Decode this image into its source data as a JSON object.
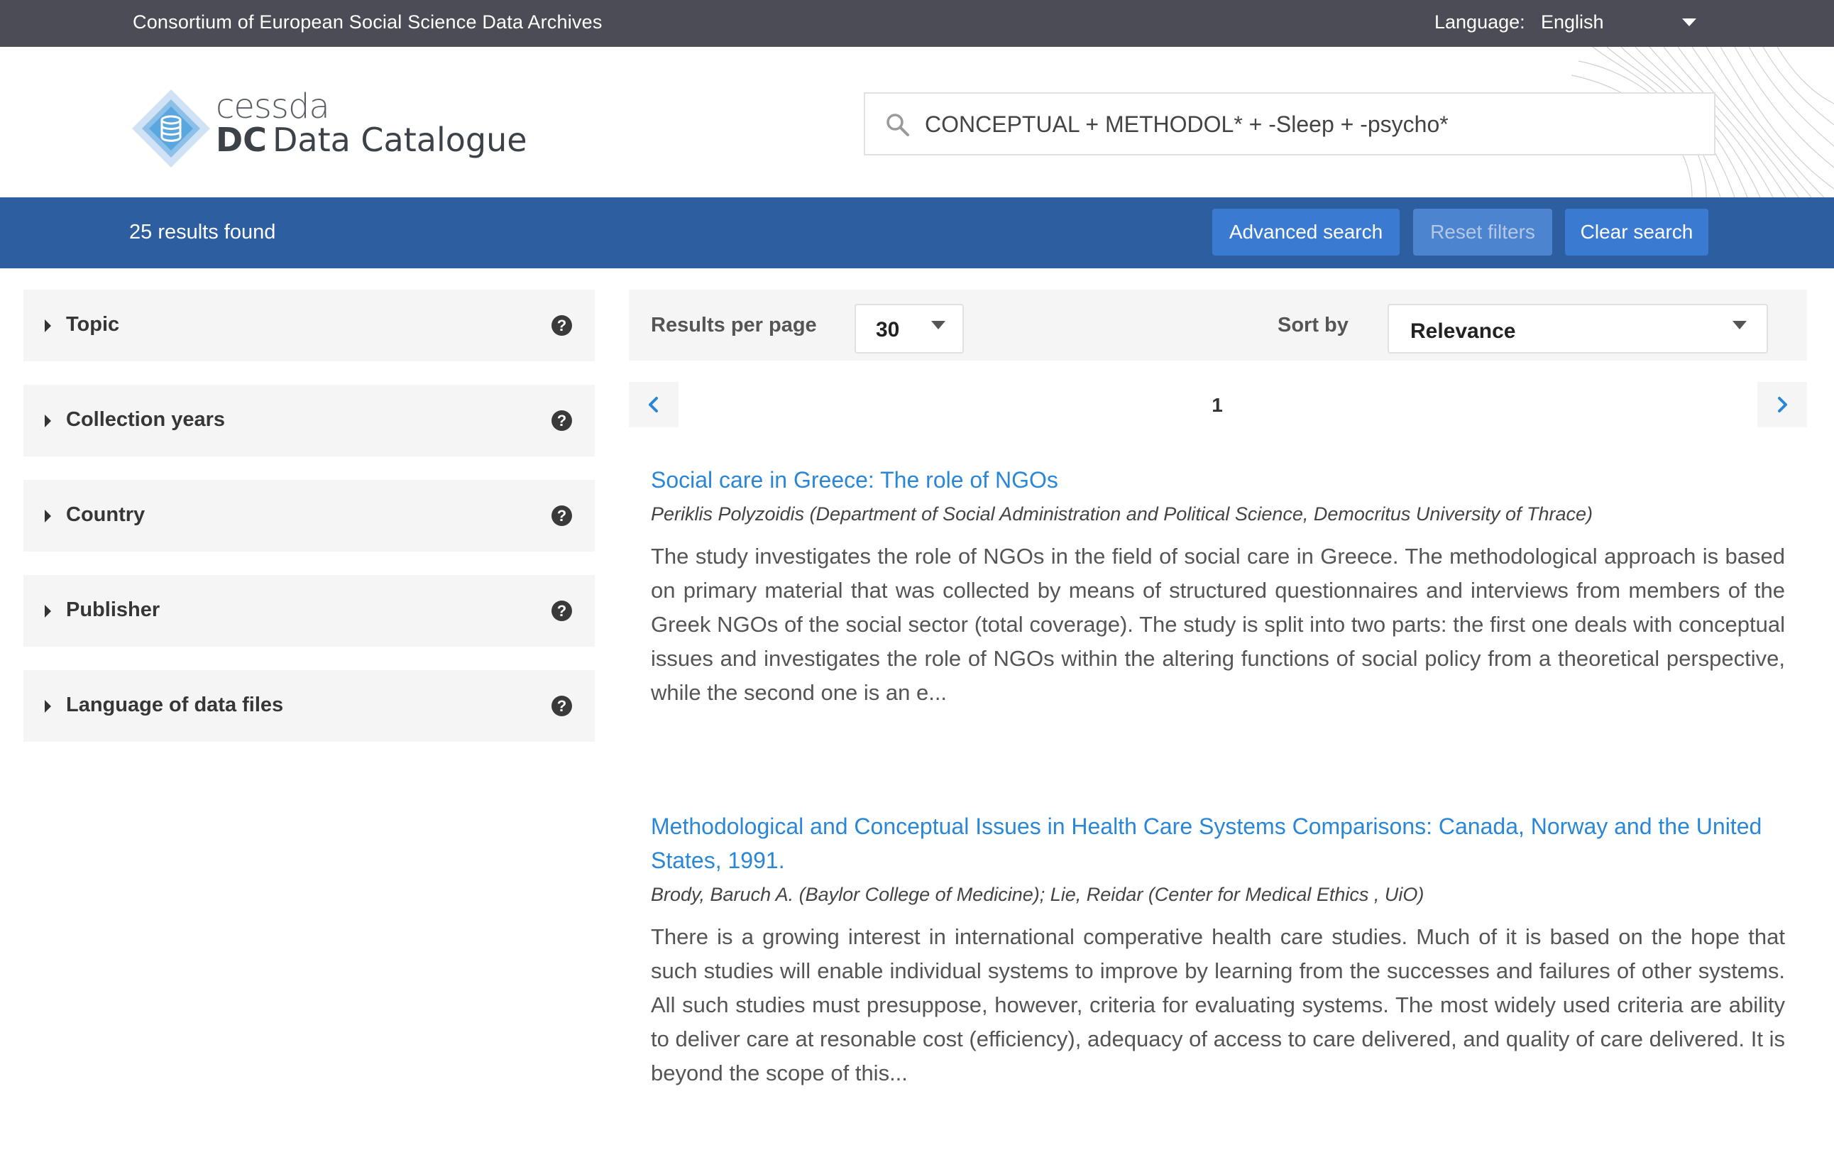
{
  "topbar": {
    "organization": "Consortium of European Social Science Data Archives",
    "language_label": "Language:",
    "language_value": "English"
  },
  "logo": {
    "line1": "cessda",
    "line2_bold": "DC",
    "line2_rest": "Data Catalogue"
  },
  "search": {
    "value": "CONCEPTUAL + METHODOL* + -Sleep + -psycho*"
  },
  "results_bar": {
    "count_text": "25 results found",
    "advanced_search": "Advanced search",
    "reset_filters": "Reset filters",
    "clear_search": "Clear search"
  },
  "sidebar": {
    "facets": [
      {
        "label": "Topic"
      },
      {
        "label": "Collection years"
      },
      {
        "label": "Country"
      },
      {
        "label": "Publisher"
      },
      {
        "label": "Language of data files"
      }
    ],
    "help_glyph": "?"
  },
  "controls": {
    "results_per_page_label": "Results per page",
    "results_per_page_value": "30",
    "sort_by_label": "Sort by",
    "sort_by_value": "Relevance"
  },
  "pagination": {
    "current_page": "1"
  },
  "results": [
    {
      "title": "Social care in Greece: The role of NGOs",
      "authors": "Periklis Polyzoidis (Department of Social Administration and Political Science, Democritus University of Thrace)",
      "abstract": "The study investigates the role of NGOs in the field of social care in Greece. The methodological approach is based on primary material that was collected by means of structured questionnaires and interviews from members of the Greek NGOs of the social sector (total coverage). The study is split into two parts: the first one deals with conceptual issues and investigates the role of NGOs within the altering functions of social policy from a theoretical perspective, while the second one is an e..."
    },
    {
      "title": "Methodological and Conceptual Issues in Health Care Systems Comparisons: Canada, Norway and the United States, 1991.",
      "authors": "Brody, Baruch A. (Baylor College of Medicine); Lie, Reidar (Center for Medical Ethics , UiO)",
      "abstract": "There is a growing interest in international comperative health care studies. Much of it is based on the hope that such studies will enable individual systems to improve by learning from the successes and failures of other systems. All such studies must presuppose, however, criteria for evaluating systems. The most widely used criteria are ability to deliver care at resonable cost (efficiency), adequacy of access to care delivered, and quality of care delivered. It is beyond the scope of this..."
    }
  ],
  "colors": {
    "topbar": "#4c4c56",
    "results_bar": "#2c5ea0",
    "button": "#3a7ad1",
    "link": "#2a87d8",
    "facet_bg": "#f5f5f5"
  },
  "icons": {
    "search": "search-icon",
    "logo": "database-icon",
    "language_caret": "caret-down-icon",
    "facet_caret": "caret-right-icon",
    "help": "question-circle-icon",
    "prev": "chevron-left-icon",
    "next": "chevron-right-icon"
  }
}
